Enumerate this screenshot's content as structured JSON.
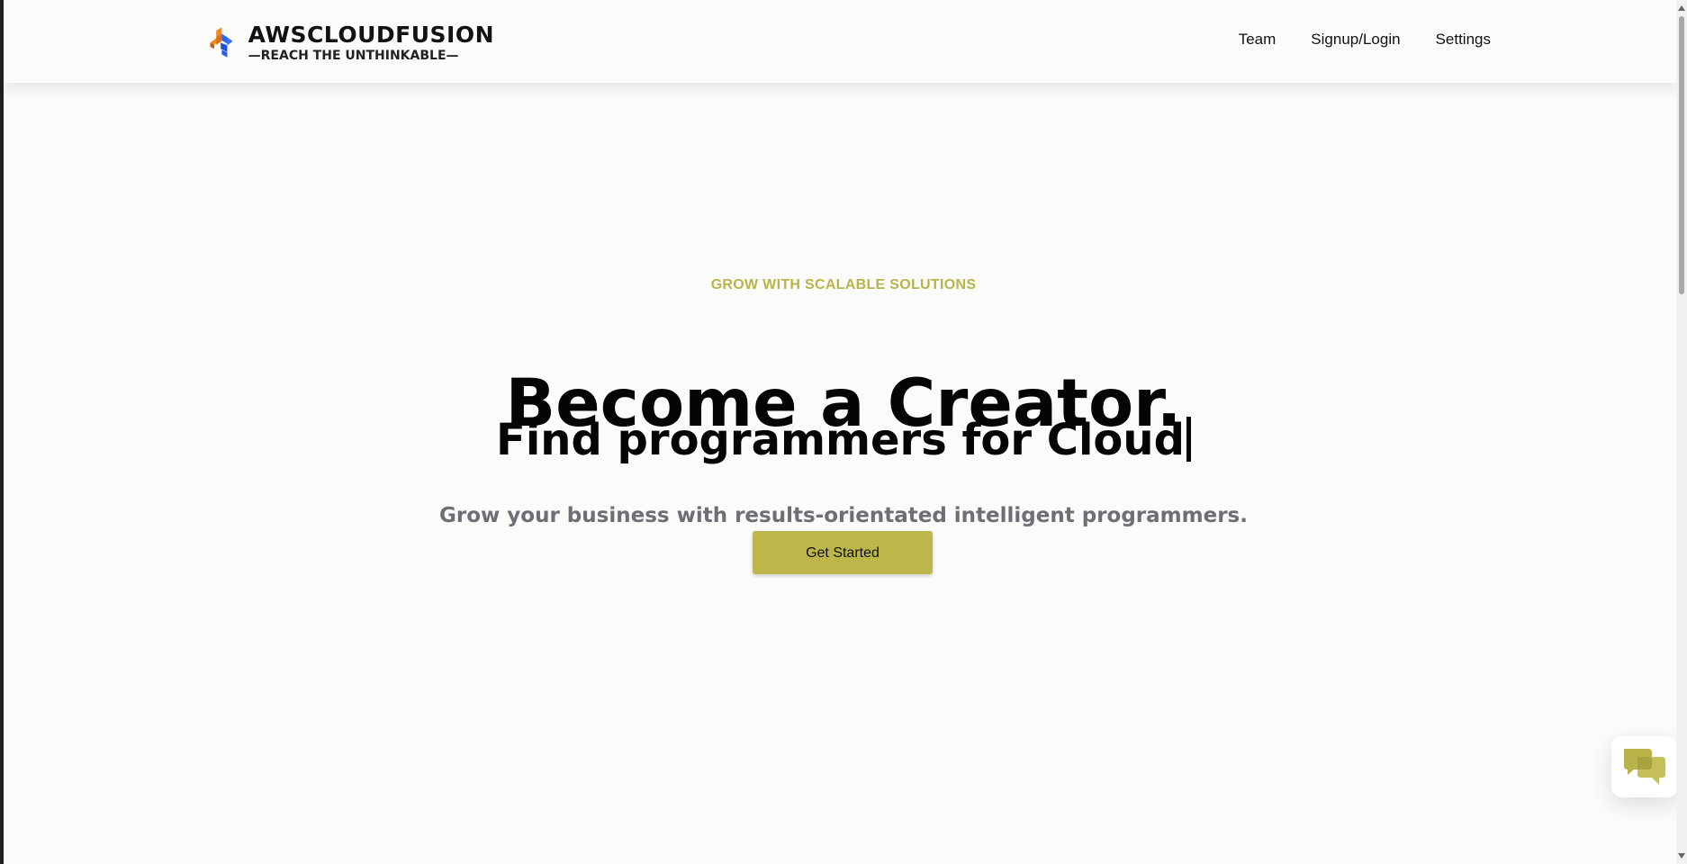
{
  "header": {
    "brand_name": "AWSCLOUDFUSION",
    "brand_tagline": "—REACH THE UNTHINKABLE—",
    "nav": [
      {
        "label": "Team"
      },
      {
        "label": "Signup/Login"
      },
      {
        "label": "Settings"
      }
    ]
  },
  "hero": {
    "eyebrow": "GROW WITH SCALABLE SOLUTIONS",
    "title": "Become a Creator.",
    "typed_text": "Find programmers for Cloud",
    "description": "Grow your business with results-orientated intelligent programmers.",
    "cta_label": "Get Started"
  },
  "icons": {
    "logo": "awscloudfusion-logo",
    "chat": "chat-bubbles-icon"
  },
  "colors": {
    "accent": "#bcb64b",
    "eyebrow": "#b9b44a",
    "logo_orange": "#e27816",
    "logo_blue": "#2458e8",
    "background": "#fbfbfa"
  }
}
